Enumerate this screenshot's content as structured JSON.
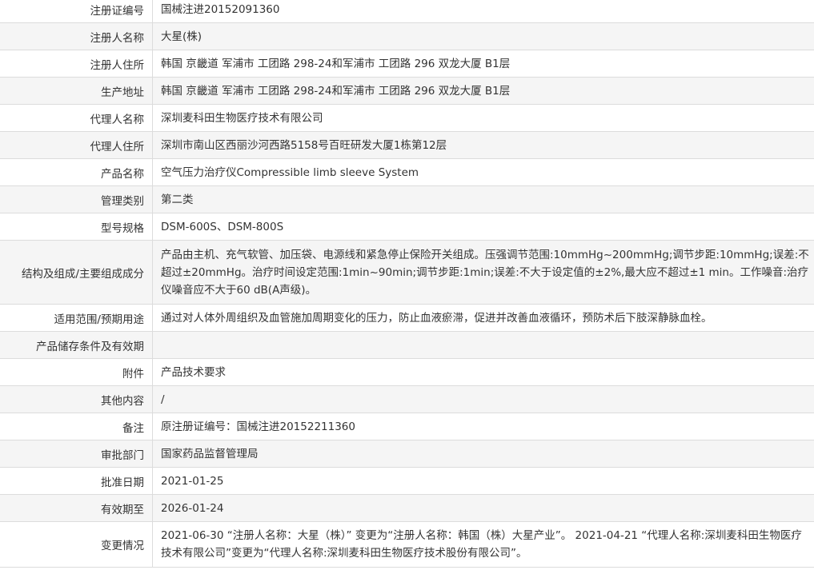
{
  "rows": [
    {
      "label": "注册证编号",
      "value": "国械注进20152091360"
    },
    {
      "label": "注册人名称",
      "value": "大星(株)"
    },
    {
      "label": "注册人住所",
      "value": "韩国 京畿道 军浦市 工团路 298-24和军浦市 工团路 296 双龙大厦 B1层"
    },
    {
      "label": "生产地址",
      "value": "韩国 京畿道 军浦市 工团路 298-24和军浦市 工团路 296 双龙大厦 B1层"
    },
    {
      "label": "代理人名称",
      "value": "深圳麦科田生物医疗技术有限公司"
    },
    {
      "label": "代理人住所",
      "value": "深圳市南山区西丽沙河西路5158号百旺研发大厦1栋第12层"
    },
    {
      "label": "产品名称",
      "value": "空气压力治疗仪Compressible limb sleeve System"
    },
    {
      "label": "管理类别",
      "value": "第二类"
    },
    {
      "label": "型号规格",
      "value": "DSM-600S、DSM-800S"
    },
    {
      "label": "结构及组成/主要组成成分",
      "value": "产品由主机、充气软管、加压袋、电源线和紧急停止保险开关组成。压强调节范围:10mmHg~200mmHg;调节步距:10mmHg;误差:不超过±20mmHg。治疗时间设定范围:1min~90min;调节步距:1min;误差:不大于设定值的±2%,最大应不超过±1 min。工作噪音:治疗仪噪音应不大于60 dB(A声级)。"
    },
    {
      "label": "适用范围/预期用途",
      "value": "通过对人体外周组织及血管施加周期变化的压力，防止血液瘀滞，促进并改善血液循环，预防术后下肢深静脉血栓。"
    },
    {
      "label": "产品储存条件及有效期",
      "value": ""
    },
    {
      "label": "附件",
      "value": "产品技术要求"
    },
    {
      "label": "其他内容",
      "value": "/"
    },
    {
      "label": "备注",
      "value": "原注册证编号：国械注进20152211360"
    },
    {
      "label": "审批部门",
      "value": "国家药品监督管理局"
    },
    {
      "label": "批准日期",
      "value": "2021-01-25"
    },
    {
      "label": "有效期至",
      "value": "2026-01-24"
    },
    {
      "label": "变更情况",
      "value": "2021-06-30 “注册人名称：大星（株）” 变更为“注册人名称：韩国（株）大星产业”。 2021-04-21 “代理人名称:深圳麦科田生物医疗技术有限公司”变更为“代理人名称:深圳麦科田生物医疗技术股份有限公司”。"
    }
  ]
}
